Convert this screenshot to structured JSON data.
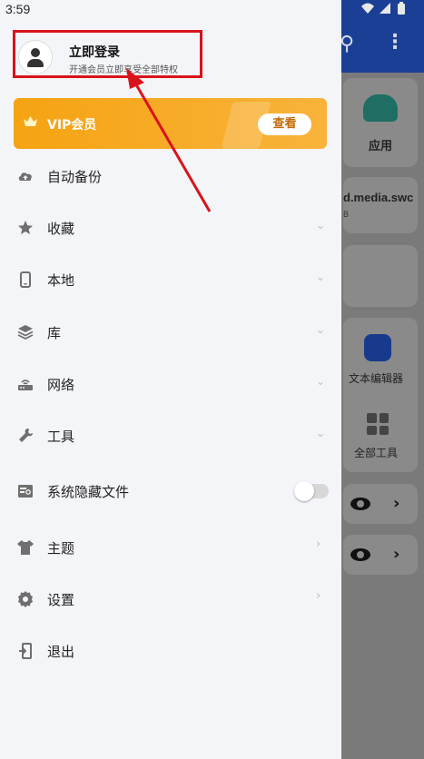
{
  "status": {
    "time": "3:59"
  },
  "profile": {
    "title": "立即登录",
    "subtitle": "开通会员立即享受全部特权"
  },
  "vip": {
    "label": "VIP会员",
    "button": "查看"
  },
  "menu": [
    {
      "label": "自动备份",
      "icon": "cloud-upload-icon",
      "has_chevron": false
    },
    {
      "label": "收藏",
      "icon": "star-icon",
      "has_chevron": true
    },
    {
      "label": "本地",
      "icon": "phone-icon",
      "has_chevron": true
    },
    {
      "label": "库",
      "icon": "layers-icon",
      "has_chevron": true
    },
    {
      "label": "网络",
      "icon": "router-icon",
      "has_chevron": true
    },
    {
      "label": "工具",
      "icon": "wrench-icon",
      "has_chevron": true
    },
    {
      "label": "系统隐藏文件",
      "icon": "hidden-files-icon",
      "toggle": false
    },
    {
      "label": "主题",
      "icon": "tshirt-icon",
      "has_chevron": true
    },
    {
      "label": "设置",
      "icon": "gear-icon",
      "has_chevron": true
    },
    {
      "label": "退出",
      "icon": "exit-icon",
      "has_chevron": false
    }
  ],
  "background": {
    "app_label": "应用",
    "file_name": "d.media.swc",
    "file_size": "B",
    "editor_label": "文本编辑器",
    "tools_label": "全部工具"
  },
  "colors": {
    "vip_orange": "#f5a312",
    "highlight_red": "#d8131b",
    "topbar_blue": "#1a3f95"
  }
}
